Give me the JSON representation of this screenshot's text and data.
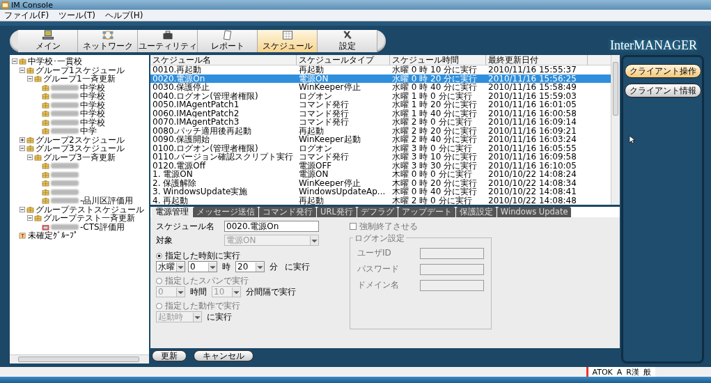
{
  "window": {
    "title": "IM Console"
  },
  "menu": [
    "ファイル(F)",
    "ツール(T)",
    "ヘルプ(H)"
  ],
  "toolbar": [
    {
      "label": "メイン",
      "selected": false
    },
    {
      "label": "ネットワーク",
      "selected": false
    },
    {
      "label": "ユーティリティ",
      "selected": false
    },
    {
      "label": "レポート",
      "selected": false
    },
    {
      "label": "スケジュール",
      "selected": true
    },
    {
      "label": "設定",
      "selected": false
    }
  ],
  "logo": "InterMANAGER",
  "tree": [
    {
      "label": "中学校･一貫校",
      "kind": "group",
      "expanded": true,
      "children": [
        {
          "label": "グループ1スケジュール",
          "kind": "group",
          "expanded": true,
          "children": [
            {
              "label": "グループ1一斉更新",
              "kind": "group",
              "expanded": true,
              "children": [
                {
                  "label": "中学校",
                  "kind": "group",
                  "redacted": true
                },
                {
                  "label": "中学校",
                  "kind": "group",
                  "redacted": true
                },
                {
                  "label": "中学校",
                  "kind": "group",
                  "redacted": true
                },
                {
                  "label": "中学校",
                  "kind": "group",
                  "redacted": true
                },
                {
                  "label": "中学校",
                  "kind": "group",
                  "redacted": true
                },
                {
                  "label": "中学",
                  "kind": "group",
                  "redacted": true
                }
              ]
            }
          ]
        },
        {
          "label": "グループ2スケジュール",
          "kind": "group",
          "expanded": false
        },
        {
          "label": "グループ3スケジュール",
          "kind": "group",
          "expanded": true,
          "children": [
            {
              "label": "グループ3一斉更新",
              "kind": "group",
              "expanded": true,
              "children": [
                {
                  "kind": "group",
                  "redacted": true
                },
                {
                  "kind": "group",
                  "redacted": true
                },
                {
                  "kind": "group",
                  "redacted": true
                },
                {
                  "kind": "group",
                  "redacted": true
                },
                {
                  "label": "-品川区評価用",
                  "kind": "group",
                  "redacted": true
                }
              ]
            }
          ]
        },
        {
          "label": "グループテストスケジュール",
          "kind": "group",
          "expanded": true,
          "children": [
            {
              "label": "グループテスト一斉更新",
              "kind": "group",
              "expanded": true,
              "children": [
                {
                  "label": "-CTS評価用",
                  "kind": "client",
                  "redacted": true
                }
              ]
            }
          ]
        }
      ]
    },
    {
      "label": "未確定ｸﾞﾙｰﾌﾟ",
      "kind": "unassigned"
    }
  ],
  "table": {
    "columns": [
      "スケジュール名",
      "スケジュールタイプ",
      "スケジュール時間",
      "最終更新日付"
    ],
    "rows": [
      {
        "cells": [
          "0010.再起動",
          "再起動",
          "水曜 0 時 10 分に実行",
          "2010/11/16 15:55:37"
        ],
        "selected": false
      },
      {
        "cells": [
          "0020.電源On",
          "電源ON",
          "水曜 0 時 20 分に実行",
          "2010/11/16 15:56:25"
        ],
        "selected": true
      },
      {
        "cells": [
          "0030.保護停止",
          "WinKeeper停止",
          "水曜 0 時 40 分に実行",
          "2010/11/16 15:58:49"
        ],
        "selected": false
      },
      {
        "cells": [
          "0040.ログオン(管理者権限)",
          "ログオン",
          "水曜 1 時 0 分に実行",
          "2010/11/16 15:59:03"
        ],
        "selected": false
      },
      {
        "cells": [
          "0050.IMAgentPatch1",
          "コマンド発行",
          "水曜 1 時 20 分に実行",
          "2010/11/16 16:01:05"
        ],
        "selected": false
      },
      {
        "cells": [
          "0060.IMAgentPatch2",
          "コマンド発行",
          "水曜 1 時 40 分に実行",
          "2010/11/16 16:00:58"
        ],
        "selected": false
      },
      {
        "cells": [
          "0070.IMAgentPatch3",
          "コマンド発行",
          "水曜 2 時 0 分に実行",
          "2010/11/16 16:09:14"
        ],
        "selected": false
      },
      {
        "cells": [
          "0080.パッチ適用後再起動",
          "再起動",
          "水曜 2 時 20 分に実行",
          "2010/11/16 16:09:21"
        ],
        "selected": false
      },
      {
        "cells": [
          "0090.保護開始",
          "WinKeeper起動",
          "水曜 2 時 40 分に実行",
          "2010/11/16 16:03:24"
        ],
        "selected": false
      },
      {
        "cells": [
          "0100.ログオン(管理者権限)",
          "ログオン",
          "水曜 3 時 0 分に実行",
          "2010/11/16 16:05:55"
        ],
        "selected": false
      },
      {
        "cells": [
          "0110.バージョン確認スクリプト実行",
          "コマンド発行",
          "水曜 3 時 10 分に実行",
          "2010/11/16 16:09:58"
        ],
        "selected": false
      },
      {
        "cells": [
          "0120.電源Off",
          "電源OFF",
          "水曜 3 時 30 分に実行",
          "2010/11/16 16:10:05"
        ],
        "selected": false
      },
      {
        "cells": [
          "1. 電源ON",
          "電源ON",
          "木曜 0 時 0 分に実行",
          "2010/10/22 14:08:24"
        ],
        "selected": false
      },
      {
        "cells": [
          "2. 保護解除",
          "WinKeeper停止",
          "木曜 0 時 20 分に実行",
          "2010/10/22 14:08:34"
        ],
        "selected": false
      },
      {
        "cells": [
          "3. WindowsUpdate実施",
          "WindowsUpdateAp...",
          "木曜 0 時 40 分に実行",
          "2010/10/22 14:08:41"
        ],
        "selected": false
      },
      {
        "cells": [
          "4. 再起動",
          "再起動",
          "木曜 2 時 0 分に実行",
          "2010/10/22 14:08:48"
        ],
        "selected": false
      }
    ]
  },
  "detail_tabs": [
    {
      "label": "電源管理",
      "selected": true
    },
    {
      "label": "メッセージ送信",
      "selected": false
    },
    {
      "label": "コマンド発行",
      "selected": false
    },
    {
      "label": "URL発行",
      "selected": false
    },
    {
      "label": "デフラグ",
      "selected": false
    },
    {
      "label": "アップデート",
      "selected": false
    },
    {
      "label": "保護設定",
      "selected": false
    },
    {
      "label": "Windows Update",
      "selected": false
    }
  ],
  "form": {
    "name_label": "スケジュール名",
    "name_value": "0020.電源On",
    "force_quit": {
      "label": "強制終了させる",
      "checked": false
    },
    "target_label": "対象",
    "target": {
      "value": "電源ON",
      "disabled": true
    },
    "modes": [
      {
        "label": "指定した時刻に実行",
        "selected": true,
        "controls": [
          {
            "kind": "select",
            "value": "水曜",
            "disabled": false
          },
          {
            "kind": "select",
            "value": "0",
            "disabled": false
          },
          {
            "kind": "text",
            "value": "時"
          },
          {
            "kind": "select",
            "value": "20",
            "disabled": false
          },
          {
            "kind": "text",
            "value": "分"
          },
          {
            "kind": "text",
            "value": "に実行"
          }
        ]
      },
      {
        "label": "指定したスパンで実行",
        "selected": false,
        "controls": [
          {
            "kind": "select",
            "value": "0",
            "disabled": true
          },
          {
            "kind": "text",
            "value": "時間"
          },
          {
            "kind": "select",
            "value": "10",
            "disabled": true
          },
          {
            "kind": "text",
            "value": "分間隔で実行"
          }
        ]
      },
      {
        "label": "指定した動作で実行",
        "selected": false,
        "controls": [
          {
            "kind": "select",
            "value": "起動時",
            "disabled": true
          },
          {
            "kind": "text",
            "value": "に実行"
          }
        ]
      }
    ],
    "logon": {
      "title": "ログオン設定",
      "fields": [
        "ユーザID",
        "パスワード",
        "ドメイン名"
      ]
    }
  },
  "buttons": [
    "更新",
    "キャンセル"
  ],
  "side_buttons": [
    {
      "label": "クライアント操作",
      "selected": true
    },
    {
      "label": "クライアント情報",
      "selected": false
    }
  ],
  "ime_bar": [
    "ATOK",
    "A",
    "R漢",
    "般"
  ]
}
